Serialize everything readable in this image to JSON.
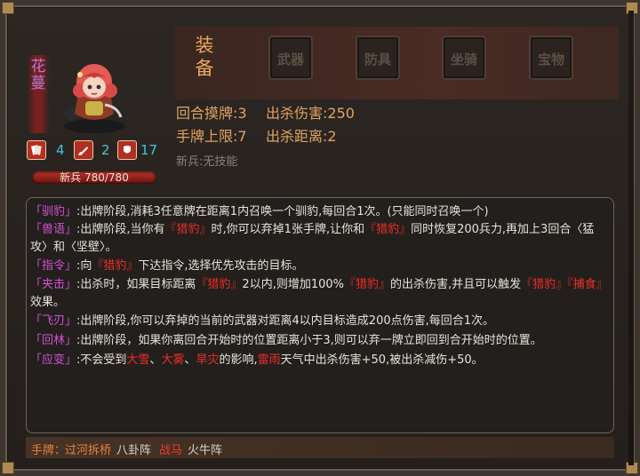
{
  "hero": {
    "name": "花\n蔓",
    "stat_cards": "4",
    "stat_attack": "2",
    "stat_defense": "17",
    "hp_label": "新兵 780/780"
  },
  "equipment": {
    "title": "装\n备",
    "slots": [
      "武器",
      "防具",
      "坐骑",
      "宝物"
    ]
  },
  "info": {
    "draw_per_turn": "回合摸牌:3",
    "kill_damage": "出杀伤害:250",
    "hand_limit": "手牌上限:7",
    "kill_distance": "出杀距离:2",
    "passive": "新兵:无技能"
  },
  "skills": [
    {
      "tag": "「驯豹」",
      "segments": [
        {
          "t": ":出牌阶段,消耗3任意牌在距离1内召唤一个驯豹,每回合1次。(只能同时召唤一个)",
          "hl": false
        }
      ]
    },
    {
      "tag": "「兽语」",
      "segments": [
        {
          "t": ":出牌阶段,当你有",
          "hl": false
        },
        {
          "t": "『猎豹』",
          "hl": true
        },
        {
          "t": "时,你可以弃掉1张手牌,让你和",
          "hl": false
        },
        {
          "t": "『猎豹』",
          "hl": true
        },
        {
          "t": "同时恢复200兵力,再加上3回合〈猛攻〉和〈坚壁〉。",
          "hl": false
        }
      ]
    },
    {
      "tag": "「指令」",
      "segments": [
        {
          "t": ":向",
          "hl": false
        },
        {
          "t": "『猎豹』",
          "hl": true
        },
        {
          "t": "下达指令,选择优先攻击的目标。",
          "hl": false
        }
      ]
    },
    {
      "tag": "「夹击」",
      "segments": [
        {
          "t": ":出杀时，如果目标距离",
          "hl": false
        },
        {
          "t": "『猎豹』",
          "hl": true
        },
        {
          "t": "2以内,则增加100%",
          "hl": false
        },
        {
          "t": "『猎豹』",
          "hl": true
        },
        {
          "t": "的出杀伤害,并且可以触发",
          "hl": false
        },
        {
          "t": "『猎豹』『捕食』",
          "hl": true
        },
        {
          "t": "效果。",
          "hl": false
        }
      ]
    },
    {
      "tag": "「飞刃」",
      "segments": [
        {
          "t": ":出牌阶段,你可以弃掉的当前的武器对距离4以内目标造成200点伤害,每回合1次。",
          "hl": false
        }
      ]
    },
    {
      "tag": "「回林」",
      "segments": [
        {
          "t": ":出牌阶段，如果你离回合开始时的位置距离小于3,则可以弃一牌立即回到合开始时的位置。",
          "hl": false
        }
      ]
    },
    {
      "tag": "「应变」",
      "segments": [
        {
          "t": ":不会受到",
          "hl": false
        },
        {
          "t": "大雪",
          "hl": true
        },
        {
          "t": "、",
          "hl": false
        },
        {
          "t": "大雾",
          "hl": true
        },
        {
          "t": "、",
          "hl": false
        },
        {
          "t": "旱灾",
          "hl": true
        },
        {
          "t": "的影响,",
          "hl": false
        },
        {
          "t": "雷雨",
          "hl": true
        },
        {
          "t": "天气中出杀伤害+50,被出杀减伤+50。",
          "hl": false
        }
      ]
    }
  ],
  "bottom": {
    "hand_label": "手牌：",
    "items": [
      {
        "t": "过河拆桥",
        "color": "#e8823a"
      },
      {
        "t": "八卦阵",
        "color": "#d8d2c8"
      },
      {
        "t": "战马",
        "color": "#ef3a2e"
      },
      {
        "t": "火牛阵",
        "color": "#d8d2c8"
      }
    ]
  },
  "colors": {
    "tag": "#cf52d4",
    "highlight": "#ef2e29",
    "info": "#e0a261",
    "stat": "#44c2de"
  }
}
